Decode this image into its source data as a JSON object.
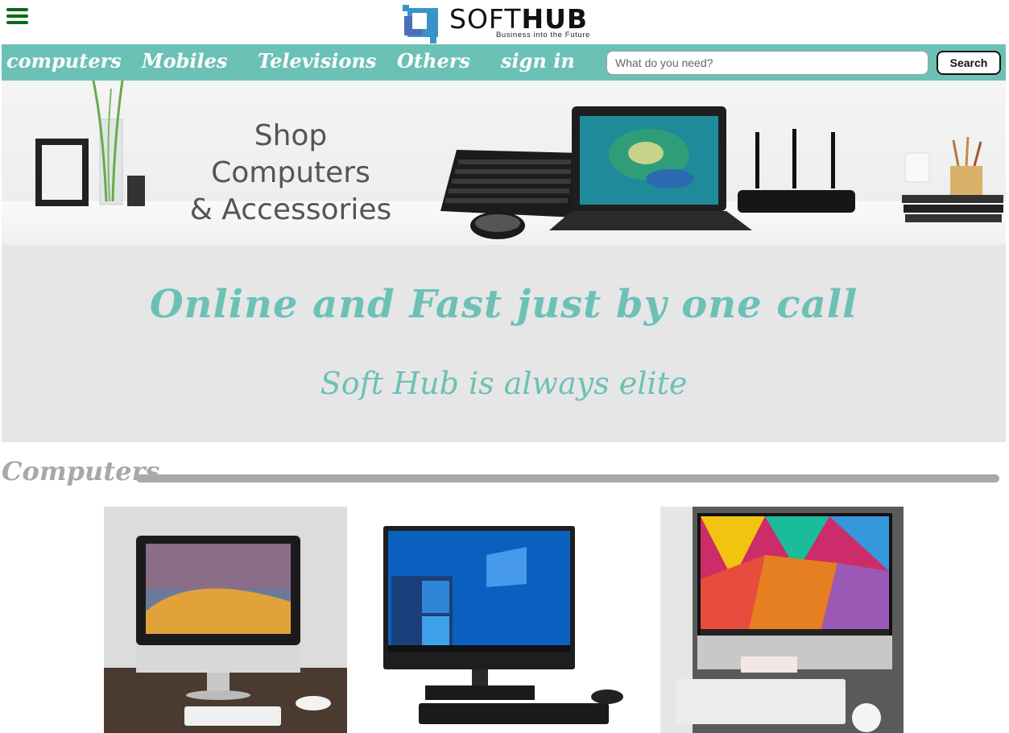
{
  "header": {
    "menu_icon": "hamburger-menu-icon",
    "logo_text_soft": "SOFT",
    "logo_text_hub": "HUB",
    "logo_tagline": "Business into the Future"
  },
  "nav": {
    "items": [
      {
        "label": "computers"
      },
      {
        "label": "Mobiles"
      },
      {
        "label": "Televisions"
      },
      {
        "label": "Others"
      },
      {
        "label": "sign in"
      }
    ],
    "search_placeholder": "What do you need?",
    "search_button": "Search"
  },
  "hero": {
    "banner_text_line1": "Shop Computers",
    "banner_text_line2": "& Accessories"
  },
  "tagline": {
    "line1": "Online and Fast just by one call",
    "line2": "Soft Hub is always elite"
  },
  "section": {
    "title": "Computers"
  },
  "colors": {
    "accent": "#6cc1b6",
    "menu_icon": "#0a6b12",
    "section_heading": "#a8a8a8"
  }
}
